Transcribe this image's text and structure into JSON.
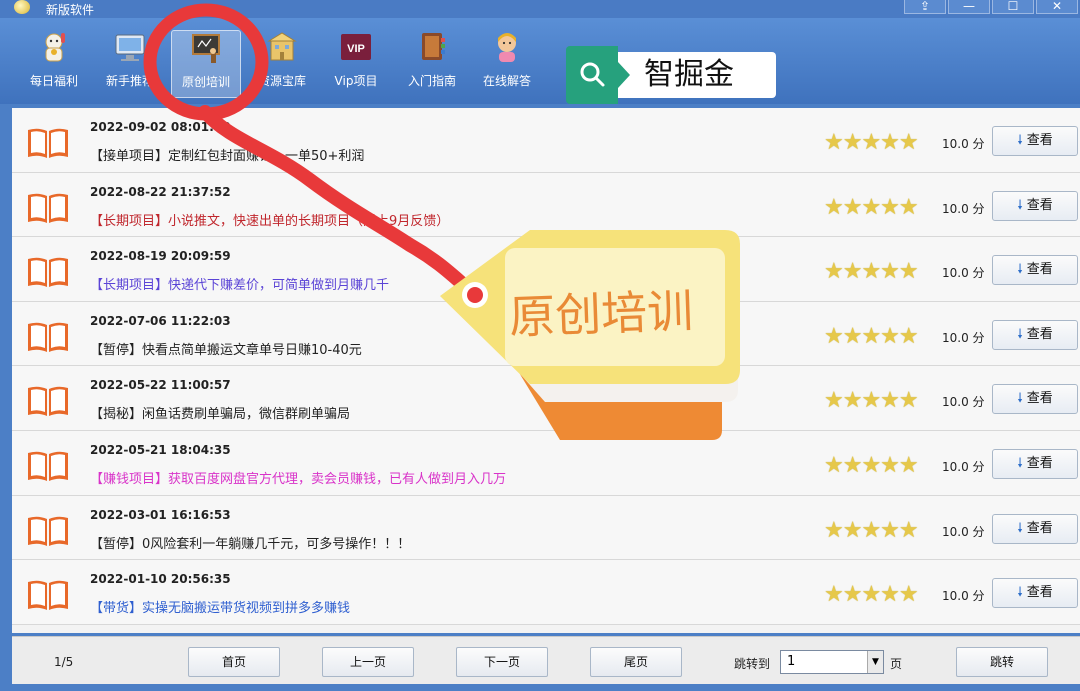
{
  "window": {
    "title": "新版软件",
    "controls": [
      "⇪",
      "—",
      "☐",
      "✕"
    ]
  },
  "toolbar": {
    "items": [
      {
        "label": "每日福利",
        "icon": "lucky-cat-icon"
      },
      {
        "label": "新手推荐",
        "icon": "monitor-icon"
      },
      {
        "label": "原创培训",
        "icon": "blackboard-icon"
      },
      {
        "label": "资源宝库",
        "icon": "building-icon"
      },
      {
        "label": "Vip项目",
        "icon": "vip-icon"
      },
      {
        "label": "入门指南",
        "icon": "book-icon"
      },
      {
        "label": "在线解答",
        "icon": "support-agent-icon"
      }
    ],
    "active_index": 2
  },
  "watermark": {
    "text": "智掘金",
    "icon": "search-icon"
  },
  "annotation": {
    "text": "原创培训"
  },
  "rows": [
    {
      "date": "2022-09-02 08:01:50",
      "title": "【接单项目】定制红包封面赚钱，一单50+利润",
      "color": "#222222",
      "stars": "★★★★★",
      "score": "10.0 分",
      "action": "查看"
    },
    {
      "date": "2022-08-22 21:37:52",
      "title": "【长期项目】小说推文，快速出单的长期项目（附上9月反馈）",
      "color": "#c0262c",
      "stars": "★★★★★",
      "score": "10.0 分",
      "action": "查看"
    },
    {
      "date": "2022-08-19 20:09:59",
      "title": "【长期项目】快递代下赚差价，可简单做到月赚几千",
      "color": "#5b44d6",
      "stars": "★★★★★",
      "score": "10.0 分",
      "action": "查看"
    },
    {
      "date": "2022-07-06 11:22:03",
      "title": "【暂停】快看点简单搬运文章单号日赚10-40元",
      "color": "#222222",
      "stars": "★★★★★",
      "score": "10.0 分",
      "action": "查看"
    },
    {
      "date": "2022-05-22 11:00:57",
      "title": "【揭秘】闲鱼话费刷单骗局，微信群刷单骗局",
      "color": "#222222",
      "stars": "★★★★★",
      "score": "10.0 分",
      "action": "查看"
    },
    {
      "date": "2022-05-21 18:04:35",
      "title": "【赚钱项目】获取百度网盘官方代理，卖会员赚钱，已有人做到月入几万",
      "color": "#d933c9",
      "stars": "★★★★★",
      "score": "10.0 分",
      "action": "查看"
    },
    {
      "date": "2022-03-01 16:16:53",
      "title": "【暂停】0风险套利一年躺赚几千元，可多号操作！！！",
      "color": "#222222",
      "stars": "★★★★★",
      "score": "10.0 分",
      "action": "查看"
    },
    {
      "date": "2022-01-10 20:56:35",
      "title": "【带货】实操无脑搬运带货视频到拼多多赚钱",
      "color": "#2f5fd0",
      "stars": "★★★★★",
      "score": "10.0 分",
      "action": "查看"
    }
  ],
  "pagination": {
    "indicator": "1/5",
    "first": "首页",
    "prev": "上一页",
    "next": "下一页",
    "last": "尾页",
    "jump_label": "跳转到",
    "jump_value": "1",
    "page_unit": "页",
    "jump_button": "跳转"
  },
  "colors": {
    "titlebar": "#4a7bc4",
    "toolbar": "#4c7fc6",
    "star": "#e6c84a",
    "annotation_red": "#e8393a",
    "tag_yellow": "#f6e27a",
    "tag_orange": "#f0a040"
  }
}
